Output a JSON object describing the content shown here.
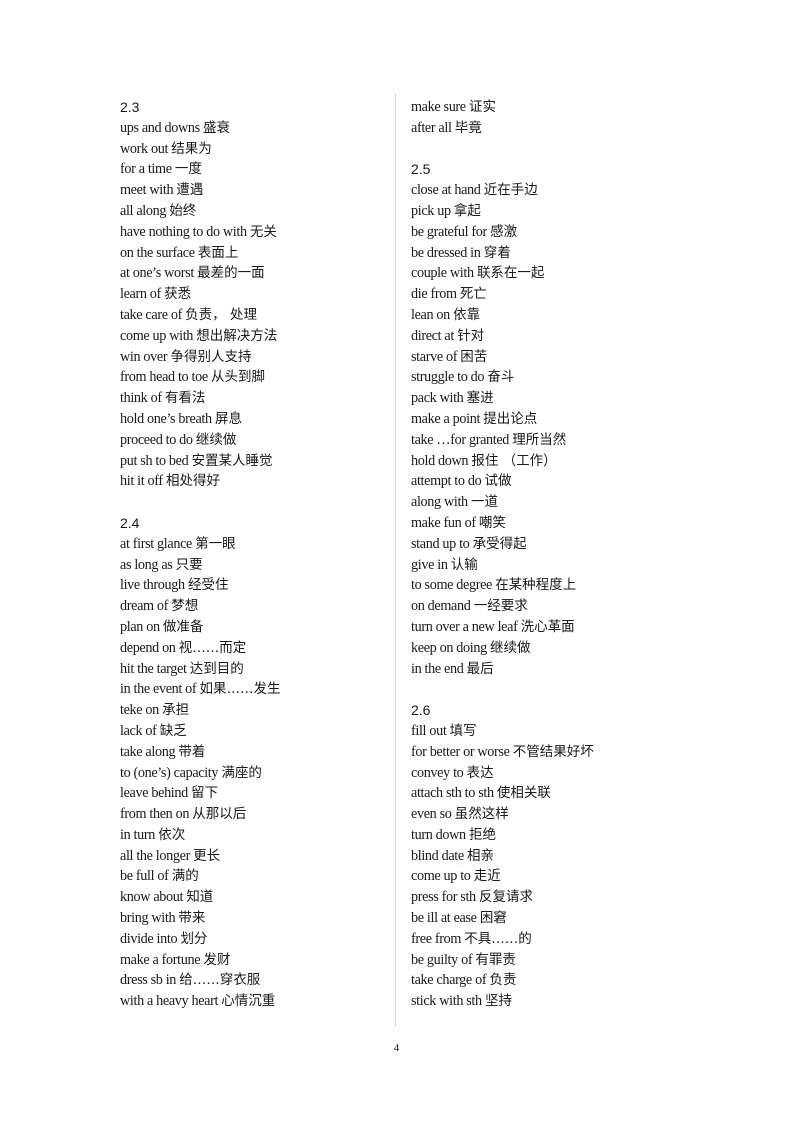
{
  "page_number": "4",
  "left_column": {
    "sections": [
      {
        "title": "2.3",
        "entries": [
          {
            "en": "ups and downs",
            "zh": "盛衰"
          },
          {
            "en": "work out",
            "zh": "结果为"
          },
          {
            "en": "for a time",
            "zh": "一度"
          },
          {
            "en": "meet with",
            "zh": "遭遇"
          },
          {
            "en": "all along",
            "zh": "始终"
          },
          {
            "en": "have nothing to do with ",
            "zh": "无关"
          },
          {
            "en": "on the surface",
            "zh": "表面上"
          },
          {
            "en": "at one’s worst ",
            "zh": "最差的一面"
          },
          {
            "en": "learn of",
            "zh": "获悉"
          },
          {
            "en": "take care of",
            "zh": "负责， 处理"
          },
          {
            "en": "come up with ",
            "zh": "想出解决方法"
          },
          {
            "en": "win over",
            "zh": "争得别人支持"
          },
          {
            "en": "from head to toe",
            "zh": "从头到脚"
          },
          {
            "en": "think of",
            "zh": "有看法"
          },
          {
            "en": "hold one’s breath ",
            "zh": "屏息"
          },
          {
            "en": "proceed to do ",
            "zh": "继续做"
          },
          {
            "en": "put sh to bed",
            "zh": "安置某人睡觉"
          },
          {
            "en": "hit it off",
            "zh": "相处得好"
          }
        ]
      },
      {
        "title": "2.4",
        "entries": [
          {
            "en": "at first glance",
            "zh": "第一眼"
          },
          {
            "en": "as long as",
            "zh": "只要"
          },
          {
            "en": "live through ",
            "zh": "经受住"
          },
          {
            "en": "dream of",
            "zh": "梦想"
          },
          {
            "en": "plan on ",
            "zh": "做准备"
          },
          {
            "en": "depend on ",
            "zh": "视……而定"
          },
          {
            "en": "hit the target",
            "zh": "达到目的"
          },
          {
            "en": "in the event of",
            "zh": "如果……发生"
          },
          {
            "en": "teke on ",
            "zh": "承担"
          },
          {
            "en": "lack of",
            "zh": "缺乏"
          },
          {
            "en": "take along ",
            "zh": "带着"
          },
          {
            "en": "to (one’s) capacity",
            "zh": "满座的"
          },
          {
            "en": "leave behind",
            "zh": "留下"
          },
          {
            "en": "from then on ",
            "zh": "从那以后"
          },
          {
            "en": "in turn",
            "zh": "依次"
          },
          {
            "en": "all the longer",
            "zh": "更长"
          },
          {
            "en": "be full of",
            "zh": "满的"
          },
          {
            "en": "know about",
            "zh": "知道"
          },
          {
            "en": "bring with ",
            "zh": "带来"
          },
          {
            "en": "divide into ",
            "zh": "划分"
          },
          {
            "en": "make a fortune",
            "zh": "发财"
          },
          {
            "en": "dress sb in ",
            "zh": "给……穿衣服"
          },
          {
            "en": "with a heavy heart",
            "zh": "心情沉重"
          }
        ]
      }
    ]
  },
  "right_column": {
    "sections": [
      {
        "title": "",
        "entries": [
          {
            "en": "make sure",
            "zh": "证实"
          },
          {
            "en": "after all",
            "zh": "毕竟"
          }
        ]
      },
      {
        "title": "2.5",
        "entries": [
          {
            "en": "close at hand",
            "zh": "近在手边"
          },
          {
            "en": "pick up",
            "zh": "拿起"
          },
          {
            "en": "be grateful for",
            "zh": "感激"
          },
          {
            "en": "be dressed in ",
            "zh": "穿着"
          },
          {
            "en": "couple with ",
            "zh": "联系在一起"
          },
          {
            "en": "die from",
            "zh": "死亡"
          },
          {
            "en": "lean on",
            "zh": "依靠"
          },
          {
            "en": "direct at ",
            "zh": "针对"
          },
          {
            "en": "starve of",
            "zh": "困苦"
          },
          {
            "en": "struggle to do",
            "zh": "奋斗"
          },
          {
            "en": "pack with ",
            "zh": "塞进"
          },
          {
            "en": "make a point",
            "zh": "提出论点"
          },
          {
            "en": "take …for granted",
            "zh": "理所当然"
          },
          {
            "en": "hold down ",
            "zh": "报住 （工作）"
          },
          {
            "en": "attempt to do ",
            "zh": "试做"
          },
          {
            "en": "along with ",
            "zh": "一道"
          },
          {
            "en": "make fun of ",
            "zh": "嘲笑"
          },
          {
            "en": "stand up to ",
            "zh": "承受得起"
          },
          {
            "en": "give in ",
            "zh": "认输"
          },
          {
            "en": "to some degree",
            "zh": "在某种程度上"
          },
          {
            "en": "on demand",
            "zh": "一经要求"
          },
          {
            "en": "turn over a new leaf",
            "zh": "洗心革面"
          },
          {
            "en": "keep on doing ",
            "zh": "继续做"
          },
          {
            "en": "in the end",
            "zh": "最后"
          }
        ]
      },
      {
        "title": "2.6",
        "entries": [
          {
            "en": "fill out",
            "zh": "填写"
          },
          {
            "en": "for better or worse",
            "zh": "不管结果好坏"
          },
          {
            "en": "convey to ",
            "zh": "表达"
          },
          {
            "en": "attach sth to sth",
            "zh": "使相关联"
          },
          {
            "en": "even so",
            "zh": "虽然这样"
          },
          {
            "en": "turn down ",
            "zh": "拒绝"
          },
          {
            "en": "blind date",
            "zh": "相亲"
          },
          {
            "en": "come up to ",
            "zh": "走近"
          },
          {
            "en": "press for sth ",
            "zh": "反复请求"
          },
          {
            "en": "be ill at ease",
            "zh": "困窘"
          },
          {
            "en": "free from",
            "zh": "不具……的"
          },
          {
            "en": "be guilty of ",
            "zh": "有罪责"
          },
          {
            "en": "take charge of",
            "zh": "负责"
          },
          {
            "en": "stick with sth ",
            "zh": "坚持"
          }
        ]
      }
    ]
  }
}
